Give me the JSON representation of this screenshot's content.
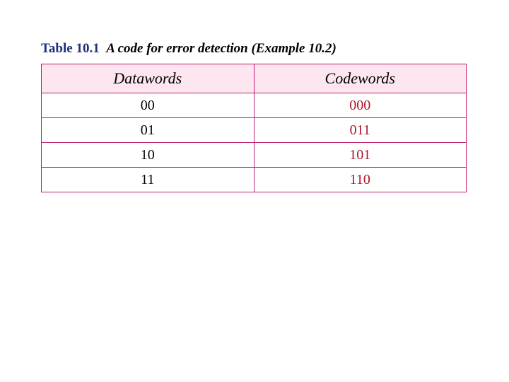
{
  "caption": {
    "label": "Table 10.1",
    "text": "A code for error detection (Example 10.2)"
  },
  "chart_data": {
    "type": "table",
    "title": "A code for error detection (Example 10.2)",
    "columns": [
      "Datawords",
      "Codewords"
    ],
    "rows": [
      {
        "dataword": "00",
        "codeword": "000"
      },
      {
        "dataword": "01",
        "codeword": "011"
      },
      {
        "dataword": "10",
        "codeword": "101"
      },
      {
        "dataword": "11",
        "codeword": "110"
      }
    ]
  }
}
